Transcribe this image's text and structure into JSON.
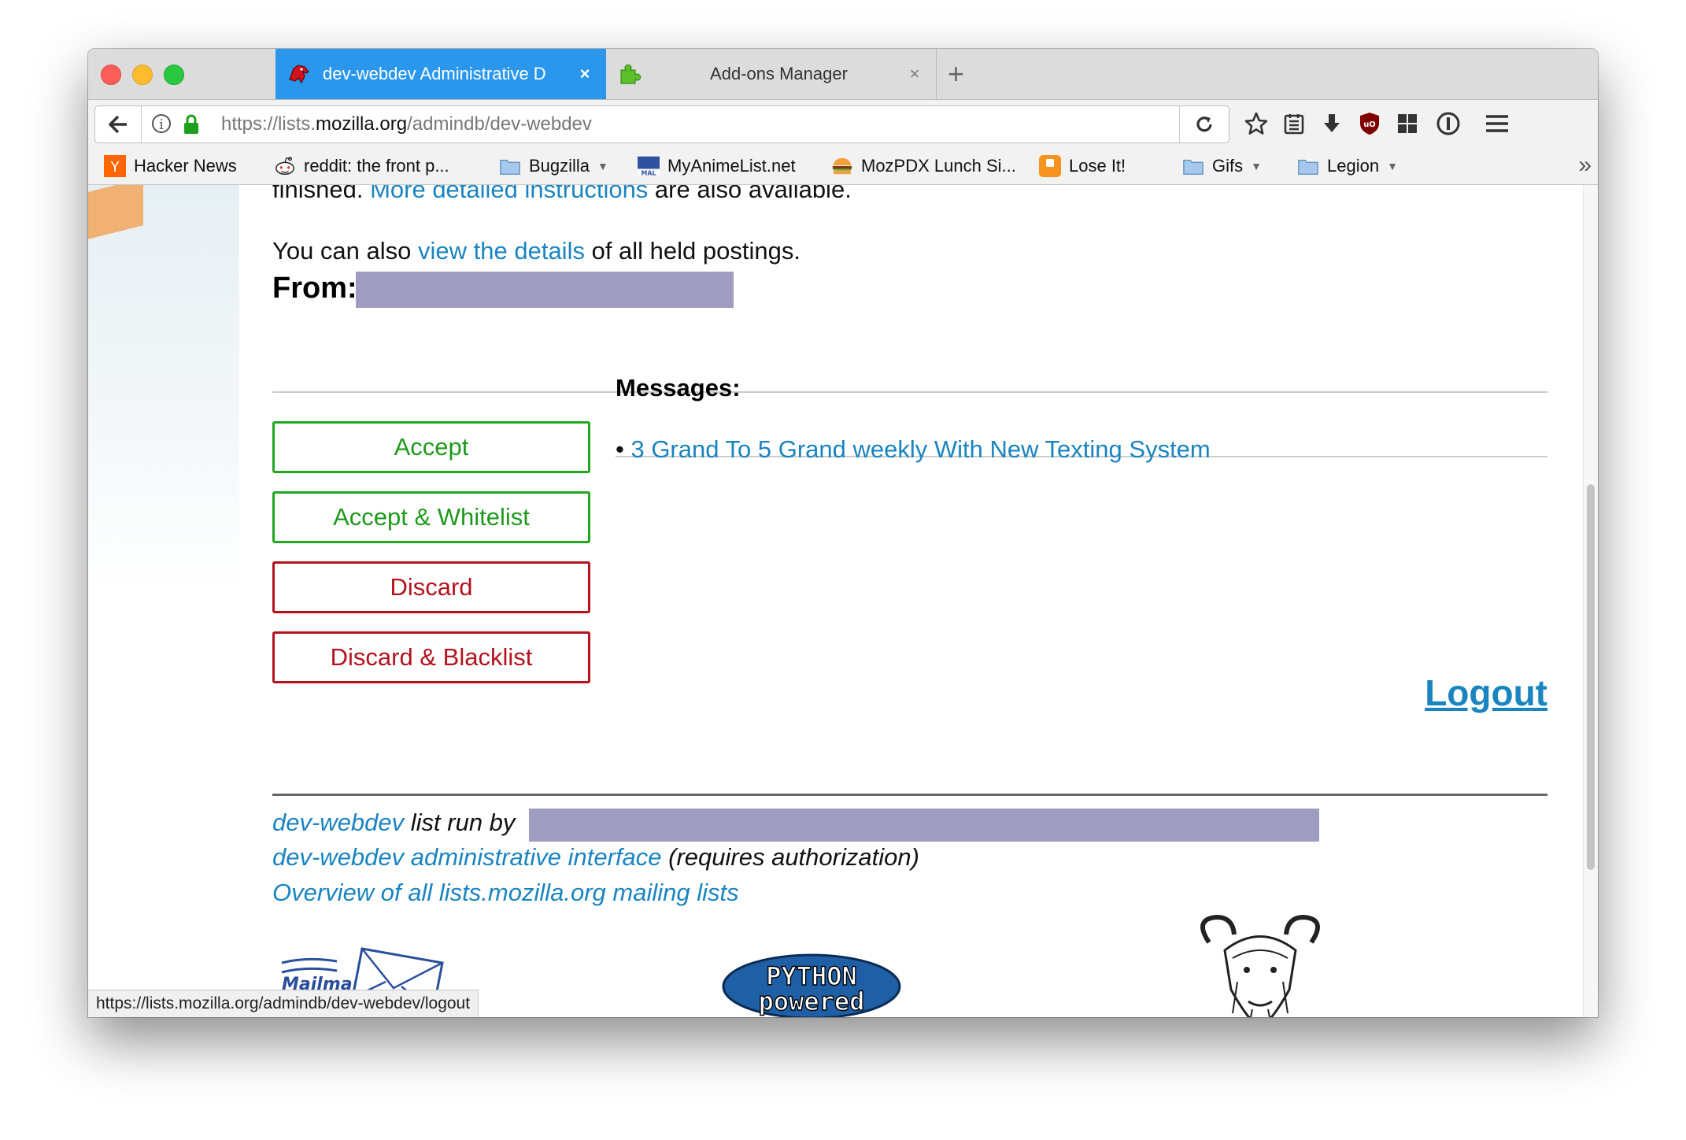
{
  "browser": {
    "tabs": [
      {
        "title": "dev-webdev Administrative D",
        "close": "×",
        "icon": "mozilla-dino-icon",
        "active": true
      },
      {
        "title": "Add-ons Manager",
        "close": "×",
        "icon": "puzzle-piece-icon",
        "active": false
      }
    ],
    "new_tab": "+",
    "url_scheme": "https://lists.",
    "url_host": "mozilla.org",
    "url_path": "/admindb/dev-webdev",
    "bookmarks": [
      {
        "label": "Hacker News",
        "icon": "hacker-news-icon"
      },
      {
        "label": "reddit: the front p...",
        "icon": "reddit-icon"
      },
      {
        "label": "Bugzilla",
        "icon": "folder-icon",
        "folder": true
      },
      {
        "label": "MyAnimeList.net",
        "icon": "myanimelist-icon"
      },
      {
        "label": "MozPDX Lunch Si...",
        "icon": "burger-icon"
      },
      {
        "label": "Lose It!",
        "icon": "lose-it-icon"
      },
      {
        "label": "Gifs",
        "icon": "folder-icon",
        "folder": true
      },
      {
        "label": "Legion",
        "icon": "folder-icon",
        "folder": true
      }
    ],
    "status_url": "https://lists.mozilla.org/admindb/dev-webdev/logout",
    "colors": {
      "active_tab": "#2b97ec",
      "link": "#1a84c0",
      "accept": "#21a61d",
      "discard": "#b3121d",
      "redaction": "#a09bc0"
    }
  },
  "page": {
    "intro_line_1": {
      "before": "finished. ",
      "link": "More detailed instructions",
      "after": " are also available."
    },
    "intro_line_2": {
      "before": "You can also ",
      "link": "view the details",
      "after": " of all held postings."
    },
    "from_label": "From:",
    "buttons": {
      "accept": "Accept",
      "accept_whitelist": "Accept & Whitelist",
      "discard": "Discard",
      "discard_blacklist": "Discard & Blacklist"
    },
    "messages_heading": "Messages:",
    "messages": [
      "3 Grand To 5 Grand weekly With New Texting System"
    ],
    "logout": "Logout",
    "footer": {
      "list_link": "dev-webdev",
      "list_run_by": " list run by ",
      "admin_link": "dev-webdev administrative interface",
      "admin_note": " (requires authorization)",
      "overview_link": "Overview of all lists.mozilla.org mailing lists"
    },
    "logos": {
      "mailman": "Mailman",
      "python_line_1": "PYTHON",
      "python_line_2": "powered"
    }
  }
}
